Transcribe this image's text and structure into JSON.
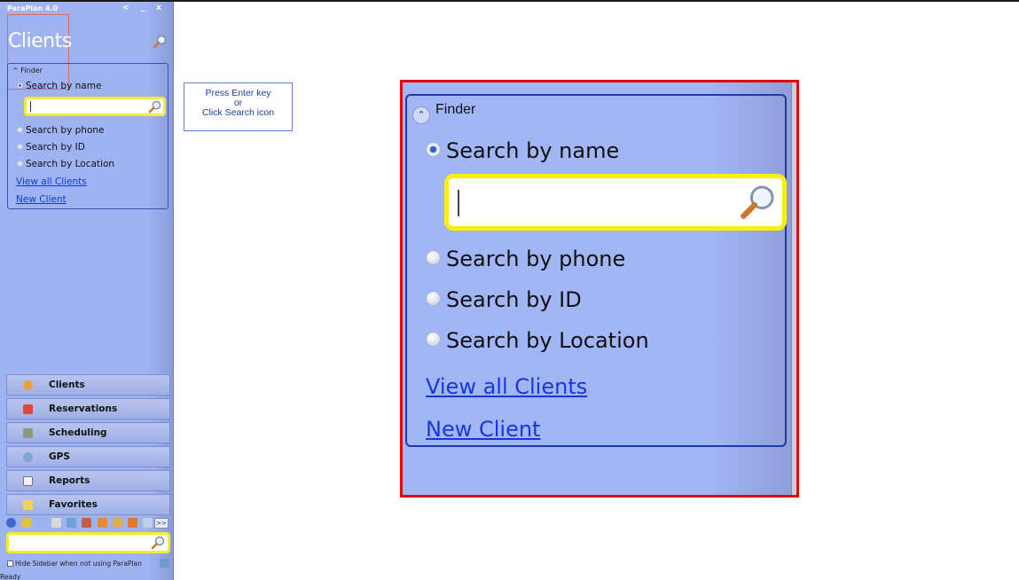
{
  "window": {
    "title": "ParaPlan 4.0",
    "controls": "< _ x",
    "module_title": "Clients"
  },
  "finder": {
    "header": "Finder",
    "options": [
      {
        "label": "Search by name",
        "selected": true
      },
      {
        "label": "Search by phone",
        "selected": false
      },
      {
        "label": "Search by ID",
        "selected": false
      },
      {
        "label": "Search by Location",
        "selected": false
      }
    ],
    "search_value": "",
    "links": [
      "View all Clients",
      "New Client"
    ]
  },
  "nav": {
    "items": [
      {
        "label": "Clients",
        "icon": "person-icon"
      },
      {
        "label": "Reservations",
        "icon": "calendar-icon"
      },
      {
        "label": "Scheduling",
        "icon": "scheduling-icon"
      },
      {
        "label": "GPS",
        "icon": "gps-icon"
      },
      {
        "label": "Reports",
        "icon": "report-icon"
      },
      {
        "label": "Favorites",
        "icon": "favorites-icon"
      }
    ],
    "more_label": ">>"
  },
  "sidebar_footer": {
    "hide_label": "Hide Sidebar when not using ParaPlan",
    "hide_checked": false,
    "status": "Ready"
  },
  "note": {
    "line1": "Press Enter key",
    "line2": "or",
    "line3": "Click Search icon"
  },
  "colors": {
    "sidebar_bg": "#9fb3f3",
    "highlight_border": "#e40909",
    "search_border": "#f2ec2e",
    "link": "#1637e0"
  }
}
